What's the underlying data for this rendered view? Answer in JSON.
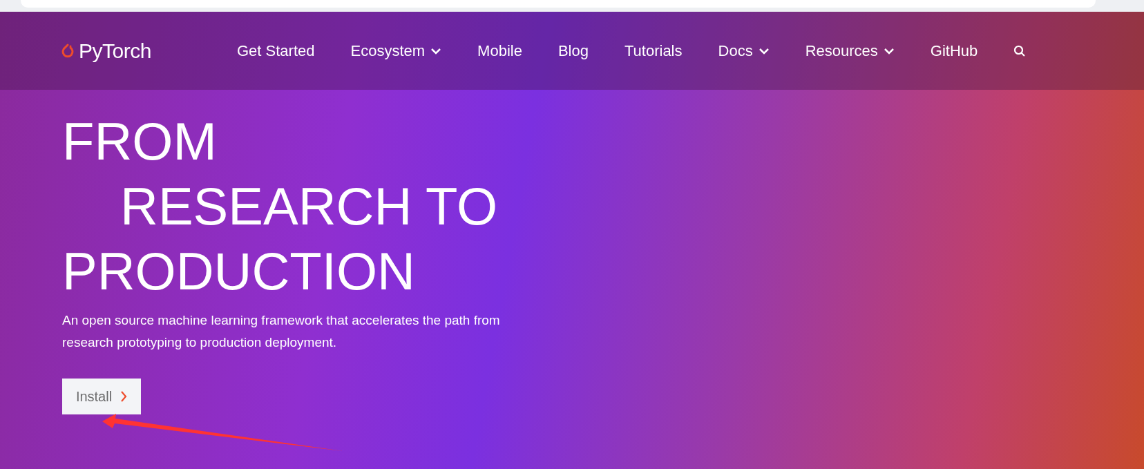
{
  "logo": {
    "text": "PyTorch"
  },
  "nav": [
    {
      "label": "Get Started",
      "dropdown": false
    },
    {
      "label": "Ecosystem",
      "dropdown": true
    },
    {
      "label": "Mobile",
      "dropdown": false
    },
    {
      "label": "Blog",
      "dropdown": false
    },
    {
      "label": "Tutorials",
      "dropdown": false
    },
    {
      "label": "Docs",
      "dropdown": true
    },
    {
      "label": "Resources",
      "dropdown": true
    },
    {
      "label": "GitHub",
      "dropdown": false
    }
  ],
  "hero": {
    "title_lines": [
      "FROM",
      "RESEARCH TO",
      "PRODUCTION"
    ],
    "description": "An open source machine learning framework that accelerates the path from research prototyping to production deployment.",
    "button": "Install"
  }
}
